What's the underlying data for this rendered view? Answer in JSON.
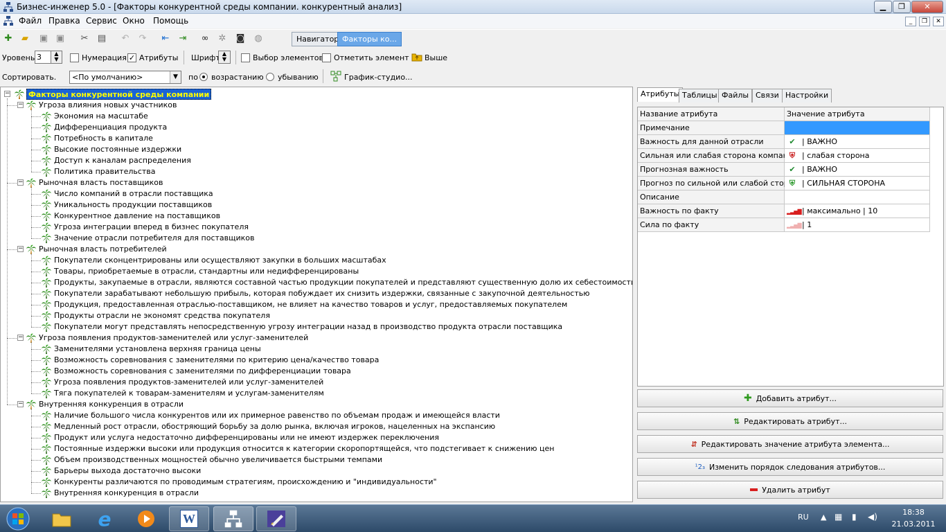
{
  "window": {
    "title": "Бизнес-инженер 5.0 - [Факторы конкурентной среды компании. конкурентный анализ]",
    "controls": [
      "minimize",
      "maximize",
      "close"
    ]
  },
  "menu": {
    "items": [
      "Файл",
      "Правка",
      "Сервис",
      "Окно",
      "Помощь"
    ]
  },
  "toolbar": {
    "icons": [
      "new-icon",
      "open-icon",
      "save-icon",
      "save-all-icon",
      "cut-icon",
      "copy-icon",
      "paste-icon",
      "undo-icon",
      "redo-icon",
      "import-icon",
      "export-icon",
      "binoculars-icon",
      "swirl-icon",
      "camera-icon",
      "globe-icon"
    ],
    "nav_tabs": [
      "Навигатор",
      "Факторы ко..."
    ]
  },
  "options": {
    "level_label": "Уровень",
    "level_value": "3",
    "numbering_label": "Нумерация",
    "numbering_checked": false,
    "attributes_label": "Атрибуты",
    "attributes_checked": true,
    "font_label": "Шрифт",
    "select_elements_label": "Выбор элементов",
    "mark_element_label": "Отметить элемент",
    "up_label": "Выше",
    "sort_label": "Сортировать.",
    "sort_value": "<По умолчанию>",
    "order_label": "по",
    "asc_label": "возрастанию",
    "desc_label": "убыванию",
    "graph_label": "График-студио..."
  },
  "tree": {
    "root": "Факторы конкурентной среды компании",
    "groups": [
      {
        "label": "Угроза влияния новых участников",
        "children": [
          "Экономия на масштабе",
          "Дифференциация продукта",
          "Потребность в капитале",
          "Высокие постоянные издержки",
          "Доступ к каналам распределения",
          "Политика правительства"
        ]
      },
      {
        "label": "Рыночная власть поставщиков",
        "children": [
          "Число компаний в отрасли поставщика",
          "Уникальность продукции поставщиков",
          "Конкурентное давление на поставщиков",
          "Угроза интеграции вперед в бизнес покупателя",
          "Значение отрасли потребителя для поставщиков"
        ]
      },
      {
        "label": "Рыночная власть потребителей",
        "children": [
          "Покупатели сконцентрированы или осуществляют закупки в больших масштабах",
          "Товары, приобретаемые в отрасли, стандартны или недифференцированы",
          "Продукты, закупаемые в отрасли, являются составной частью продукции покупателей и представляют существенную долю их себестоимости",
          "Покупатели зарабатывают небольшую прибыль, которая побуждает их снизить издержки, связанные с закупочной деятельностью",
          "Продукция, предоставленная отраслью-поставщиком, не влияет на качество товаров и услуг, предоставляемых покупателем",
          "Продукты отрасли не экономят средства покупателя",
          "Покупатели могут представлять непосредственную угрозу интеграции назад в производство продукта отрасли поставщика"
        ]
      },
      {
        "label": "Угроза появления продуктов-заменителей или услуг-заменителей",
        "children": [
          "Заменителями установлена верхняя граница цены",
          "Возможность соревнования с заменителями по критерию цена/качество товара",
          "Возможность соревнования с заменителями по дифференциации товара",
          "Угроза появления продуктов-заменителей или услуг-заменителей",
          "Тяга покупателей к товарам-заменителям и услугам-заменителям"
        ]
      },
      {
        "label": "Внутренняя конкуренция в отрасли",
        "children": [
          "Наличие большого числа конкурентов или их примерное равенство по объемам продаж и имеющейся власти",
          "Медленный рост отрасли, обостряющий борьбу за долю рынка, включая игроков, нацеленных на экспансию",
          "Продукт или услуга недостаточно дифференцированы или не имеют издержек переключения",
          "Постоянные издержки высоки или продукция относится к категории скоропортящейся, что подстегивает к снижению цен",
          "Объем производственных мощностей обычно увеличивается быстрыми темпами",
          "Барьеры выхода достаточно высоки",
          "Конкуренты различаются по проводимым стратегиям, происхождению и \"индивидуальности\"",
          "Внутренняя конкуренция в отрасли"
        ]
      }
    ]
  },
  "right_tabs": [
    "Атрибуты",
    "Таблицы",
    "Файлы",
    "Связи",
    "Настройки"
  ],
  "attributes": {
    "header_name": "Название атрибута",
    "header_value": "Значение атрибута",
    "rows": [
      {
        "name": "Примечание",
        "value": "",
        "icon": "",
        "selected": true
      },
      {
        "name": "Важность для данной отрасли",
        "value": "| ВАЖНО",
        "icon": "checkmark-icon"
      },
      {
        "name": "Сильная или слабая сторона компании",
        "value": "| слабая сторона",
        "icon": "red-shield-icon"
      },
      {
        "name": "Прогнозная важность",
        "value": "| ВАЖНО",
        "icon": "checkmark-icon"
      },
      {
        "name": "Прогноз по сильной или слабой стороне",
        "value": "| СИЛЬНАЯ СТОРОНА",
        "icon": "green-shield-icon"
      },
      {
        "name": "Описание",
        "value": "",
        "icon": ""
      },
      {
        "name": "Важность по факту",
        "value": "| максимально | 10",
        "icon": "signal-bars-icon"
      },
      {
        "name": "Сила по факту",
        "value": "| 1",
        "icon": "signal-bars-faded-icon"
      }
    ]
  },
  "actions": {
    "add": "Добавить атрибут...",
    "edit": "Редактировать атрибут...",
    "edit_value": "Редактировать значение атрибута элемента...",
    "reorder": "Изменить порядок следования атрибутов...",
    "delete": "Удалить атрибут"
  },
  "taskbar": {
    "language": "RU",
    "time": "18:38",
    "date": "21.03.2011",
    "apps": [
      "start-orb-icon",
      "explorer-icon",
      "ie-icon",
      "media-player-icon",
      "word-icon",
      "business-engineer-icon",
      "pen-app-icon"
    ]
  },
  "colors": {
    "selection": "#3399ff",
    "root_highlight": "#1a63d6",
    "root_text": "#ffff00",
    "tree_icon_green": "#2f8a1f",
    "tree_icon_orange": "#e8a000"
  }
}
